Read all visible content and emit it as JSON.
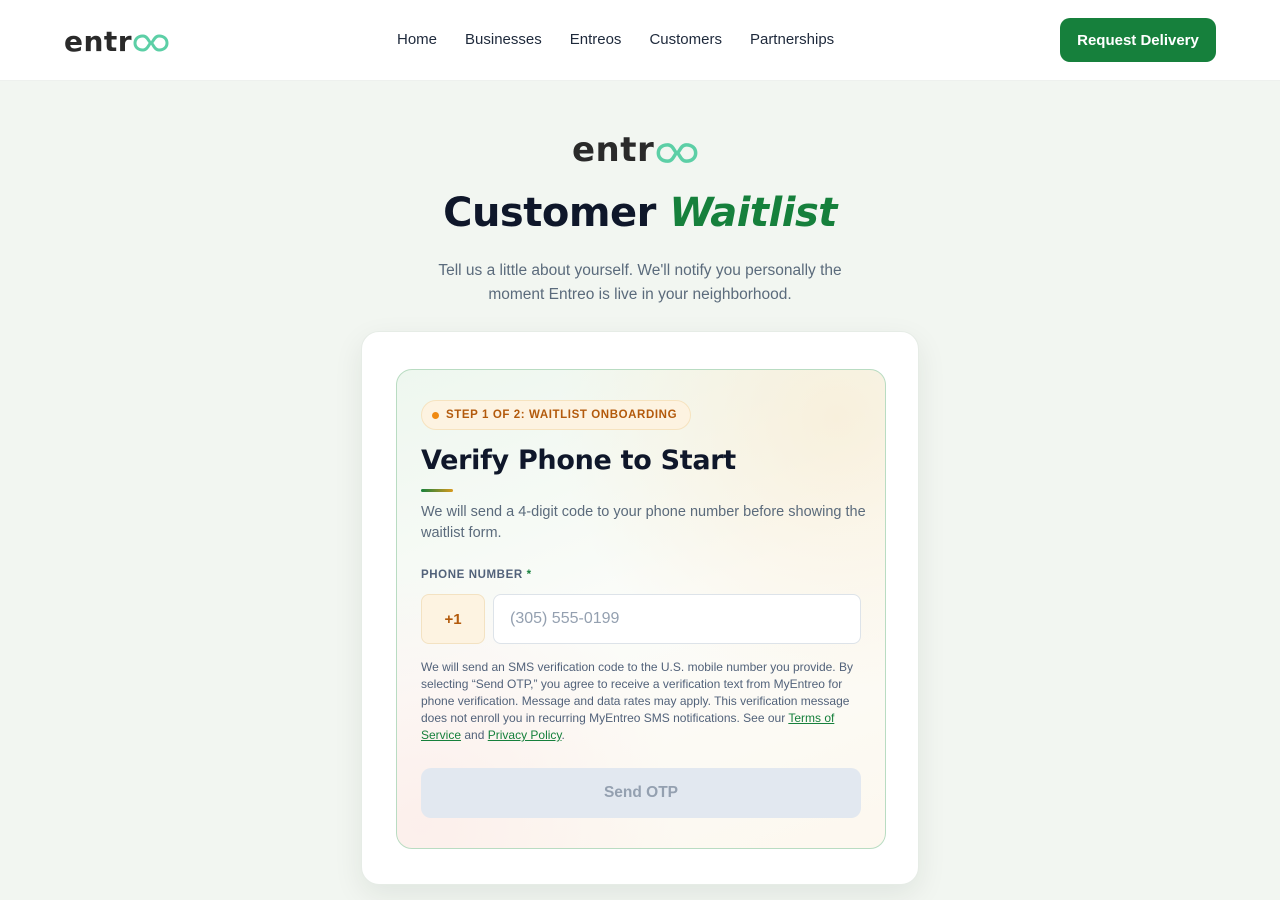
{
  "brand": {
    "wordmark": "entr",
    "accent_color": "#5ccfa6",
    "primary_color": "#16803c"
  },
  "nav": {
    "links": [
      "Home",
      "Businesses",
      "Entreos",
      "Customers",
      "Partnerships"
    ],
    "cta_label": "Request Delivery"
  },
  "hero": {
    "title_main": "Customer",
    "title_accent": "Waitlist",
    "subtitle": "Tell us a little about yourself. We'll notify you personally the moment Entreo is live in your neighborhood."
  },
  "card": {
    "step_badge": "STEP 1 OF 2: WAITLIST ONBOARDING",
    "title": "Verify Phone to Start",
    "description": "We will send a 4-digit code to your phone number before showing the waitlist form.",
    "phone_label": "PHONE NUMBER",
    "required_mark": "*",
    "country_code": "+1",
    "phone_placeholder": "(305) 555-0199",
    "consent_text": "We will send an SMS verification code to the U.S. mobile number you provide. By selecting “Send OTP,” you agree to receive a verification text from MyEntreo for phone verification. Message and data rates may apply. This verification message does not enroll you in recurring MyEntreo SMS notifications. See our",
    "terms_label": "Terms of Service",
    "and_text": "and",
    "privacy_label": "Privacy Policy",
    "period": ".",
    "submit_label": "Send OTP"
  }
}
